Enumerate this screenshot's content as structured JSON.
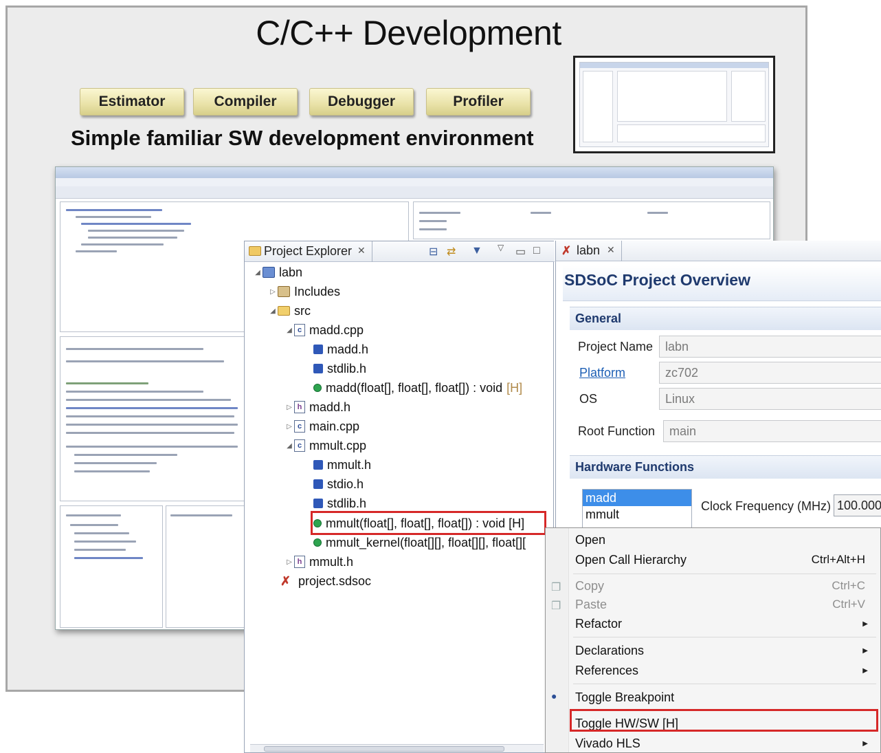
{
  "slide": {
    "title": "C/C++ Development",
    "tools": [
      "Estimator",
      "Compiler",
      "Debugger",
      "Profiler"
    ],
    "subtitle": "Simple familiar SW development environment"
  },
  "explorer": {
    "tab_label": "Project Explorer",
    "close_glyph": "✕",
    "tree": {
      "project": "labn",
      "includes": "Includes",
      "src": "src",
      "madd_cpp": "madd.cpp",
      "madd_h_inc": "madd.h",
      "stdlib_h_inc": "stdlib.h",
      "madd_fn": "madd(float[], float[], float[]) : void",
      "madd_fn_tag": "[H]",
      "madd_h": "madd.h",
      "main_cpp": "main.cpp",
      "mmult_cpp": "mmult.cpp",
      "mmult_h_inc": "mmult.h",
      "stdio_h_inc": "stdio.h",
      "stdlib_h_inc2": "stdlib.h",
      "mmult_fn": "mmult(float[], float[], float[]) : void [H]",
      "mmult_kernel_fn": "mmult_kernel(float[][], float[][], float[][",
      "mmult_h": "mmult.h",
      "project_sdsoc": "project.sdsoc"
    }
  },
  "sdsoc": {
    "tab_label": "labn",
    "close_glyph": "✕",
    "header": "SDSoC Project Overview",
    "general": {
      "title": "General",
      "project_name_label": "Project Name",
      "project_name": "labn",
      "platform_label": "Platform",
      "platform": "zc702",
      "os_label": "OS",
      "os": "Linux",
      "root_function_label": "Root Function",
      "root_function": "main"
    },
    "hardware": {
      "title": "Hardware Functions",
      "functions": [
        "madd",
        "mmult"
      ],
      "clock_label": "Clock Frequency (MHz)",
      "clock_value": "100.000"
    }
  },
  "context_menu": {
    "open": "Open",
    "open_call_hierarchy": "Open Call Hierarchy",
    "open_call_hierarchy_shortcut": "Ctrl+Alt+H",
    "copy": "Copy",
    "copy_shortcut": "Ctrl+C",
    "paste": "Paste",
    "paste_shortcut": "Ctrl+V",
    "refactor": "Refactor",
    "declarations": "Declarations",
    "references": "References",
    "toggle_breakpoint": "Toggle Breakpoint",
    "toggle_hw_sw": "Toggle HW/SW [H]",
    "vivado_hls": "Vivado HLS"
  },
  "colors": {
    "highlight_red": "#d62828",
    "selection_blue": "#3d8ee9",
    "section_title": "#1f3a6e"
  }
}
